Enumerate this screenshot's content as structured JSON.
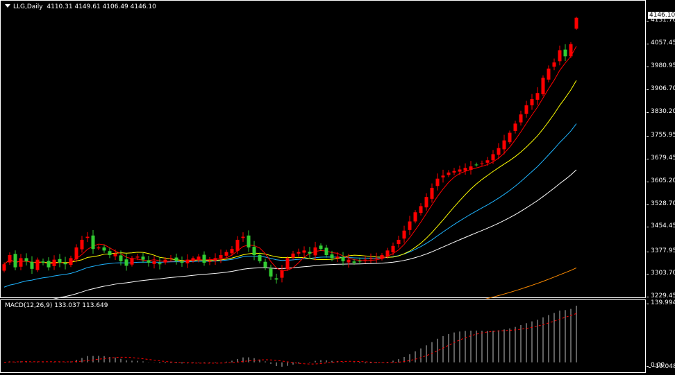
{
  "header": {
    "symbol": "LLG,Daily",
    "open": "4110.31",
    "high": "4149.61",
    "low": "4106.49",
    "close": "4146.10"
  },
  "price_axis": {
    "current": "4146.10",
    "labels": [
      "4131.70",
      "4057.45",
      "3980.95",
      "3906.70",
      "3830.20",
      "3755.95",
      "3679.45",
      "3605.20",
      "3528.70",
      "3454.45",
      "3377.95",
      "3303.70",
      "3229.45"
    ]
  },
  "macd": {
    "label": "MACD(12,26,9) 133.037 113.649",
    "max_label": "139.994",
    "zero_label": "0.00",
    "min_label": "-19.048"
  },
  "colors": {
    "bull": "#ff0000",
    "bear": "#32cd32",
    "ma_fast": "#ff0000",
    "ma_mid": "#ffff00",
    "ma_slow": "#1eb4ff",
    "ma_long": "#ffffff",
    "ma_xlong": "#ff8c00"
  },
  "chart_data": {
    "type": "candlestick",
    "ylim": [
      3229.45,
      4131.7
    ],
    "last_ohlc": [
      4110.31,
      4149.61,
      4106.49,
      4146.1
    ],
    "closes": [
      3340,
      3370,
      3330,
      3360,
      3350,
      3325,
      3355,
      3345,
      3330,
      3355,
      3345,
      3340,
      3360,
      3395,
      3420,
      3430,
      3390,
      3395,
      3385,
      3370,
      3375,
      3350,
      3335,
      3360,
      3365,
      3355,
      3345,
      3350,
      3340,
      3355,
      3360,
      3350,
      3345,
      3355,
      3360,
      3365,
      3345,
      3350,
      3360,
      3370,
      3380,
      3390,
      3420,
      3430,
      3395,
      3370,
      3350,
      3330,
      3300,
      3290,
      3320,
      3360,
      3375,
      3380,
      3385,
      3375,
      3395,
      3390,
      3370,
      3360,
      3365,
      3350,
      3355,
      3345,
      3350,
      3355,
      3360,
      3360,
      3370,
      3385,
      3400,
      3420,
      3450,
      3480,
      3510,
      3530,
      3560,
      3590,
      3620,
      3630,
      3640,
      3645,
      3650,
      3655,
      3660,
      3665,
      3670,
      3680,
      3700,
      3720,
      3745,
      3770,
      3800,
      3830,
      3860,
      3880,
      3900,
      3950,
      3980,
      4000,
      4040,
      4020,
      4060,
      4146
    ]
  }
}
